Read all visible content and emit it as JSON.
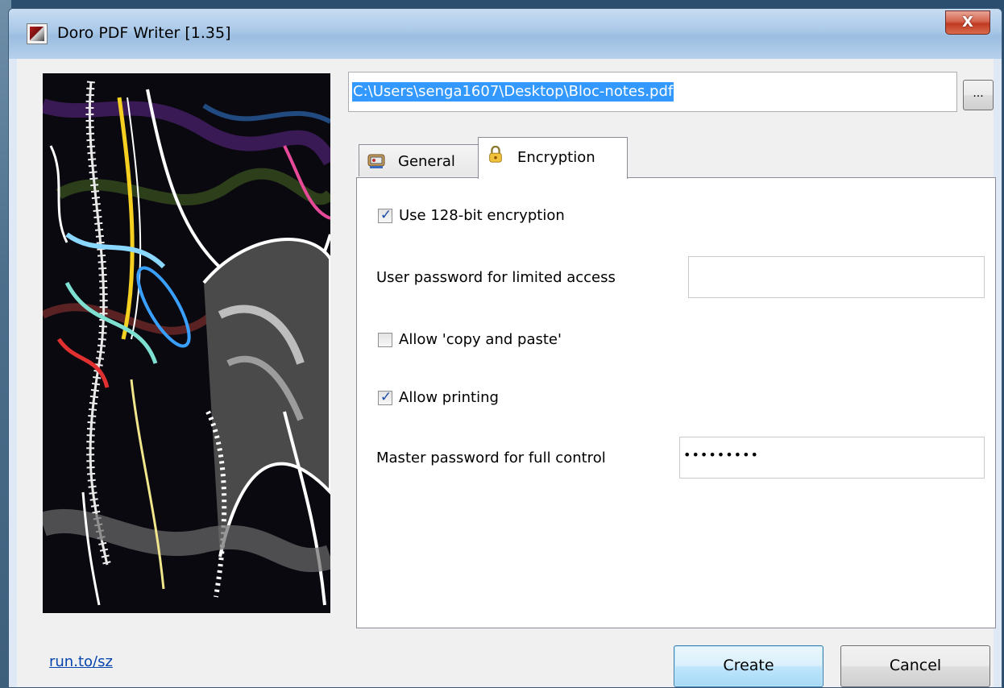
{
  "window": {
    "title": "Doro PDF Writer [1.35]",
    "close_label": "X"
  },
  "output_path": "C:\\Users\\senga1607\\Desktop\\Bloc-notes.pdf",
  "browse_label": "...",
  "tabs": [
    {
      "label": "General",
      "icon": "general-tab-icon",
      "active": false
    },
    {
      "label": "Encryption",
      "icon": "lock-icon",
      "active": true
    }
  ],
  "encryption": {
    "use_128bit": {
      "label": "Use 128-bit encryption",
      "checked": true
    },
    "user_password": {
      "label": "User password for limited access",
      "value": ""
    },
    "allow_copy": {
      "label": "Allow 'copy and paste'",
      "checked": false
    },
    "allow_printing": {
      "label": "Allow printing",
      "checked": true
    },
    "master_password": {
      "label": "Master password for full control",
      "value": "•••••••••"
    }
  },
  "footer": {
    "link": "run.to/sz",
    "create_label": "Create",
    "cancel_label": "Cancel"
  },
  "colors": {
    "selection": "#3399ff",
    "link": "#0645ad",
    "check": "#1a4aa8"
  }
}
